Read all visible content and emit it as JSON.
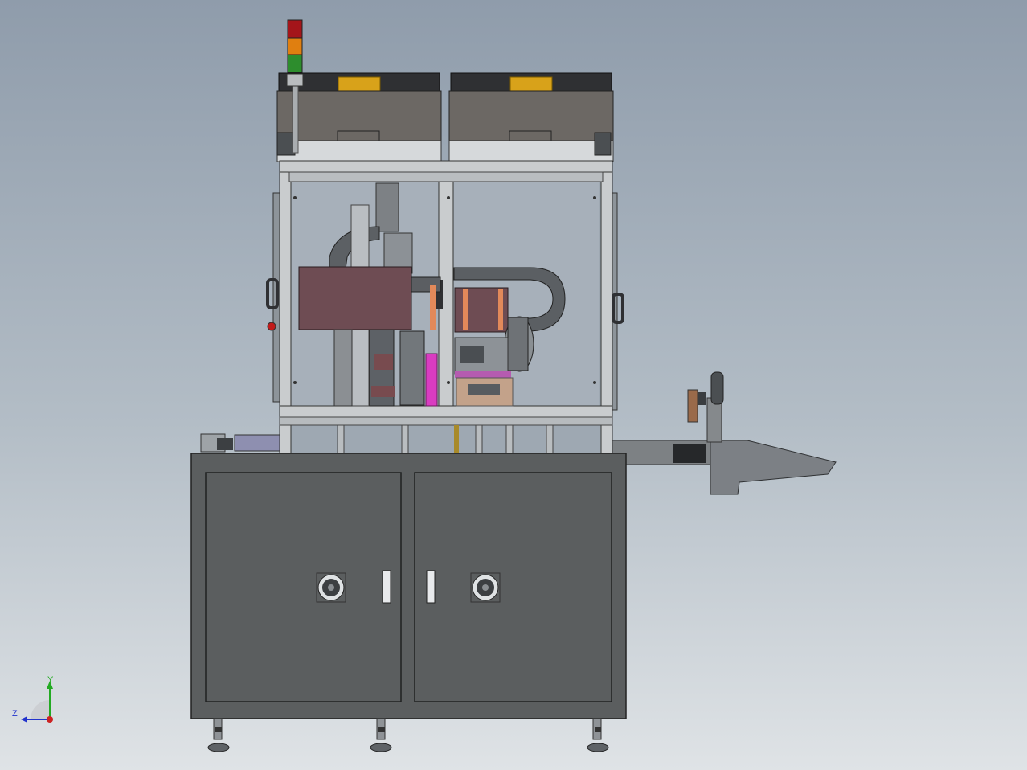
{
  "viewport": {
    "background_top": "#8f9cab",
    "background_bottom": "#dfe3e6"
  },
  "model": {
    "frame_color": "#c9ccce",
    "cabinet_color": "#5b5e5f",
    "cover_color": "#6c6864",
    "cover_top_color": "#2f3033",
    "label_color": "#d8a21a",
    "fixture_color": "#6e4c53",
    "signal_light": [
      "red",
      "orange",
      "green"
    ]
  },
  "triad": {
    "y_label": "Y",
    "z_label": "Z",
    "x_color": "#cc2222",
    "y_color": "#22aa22",
    "z_color": "#2233cc"
  }
}
